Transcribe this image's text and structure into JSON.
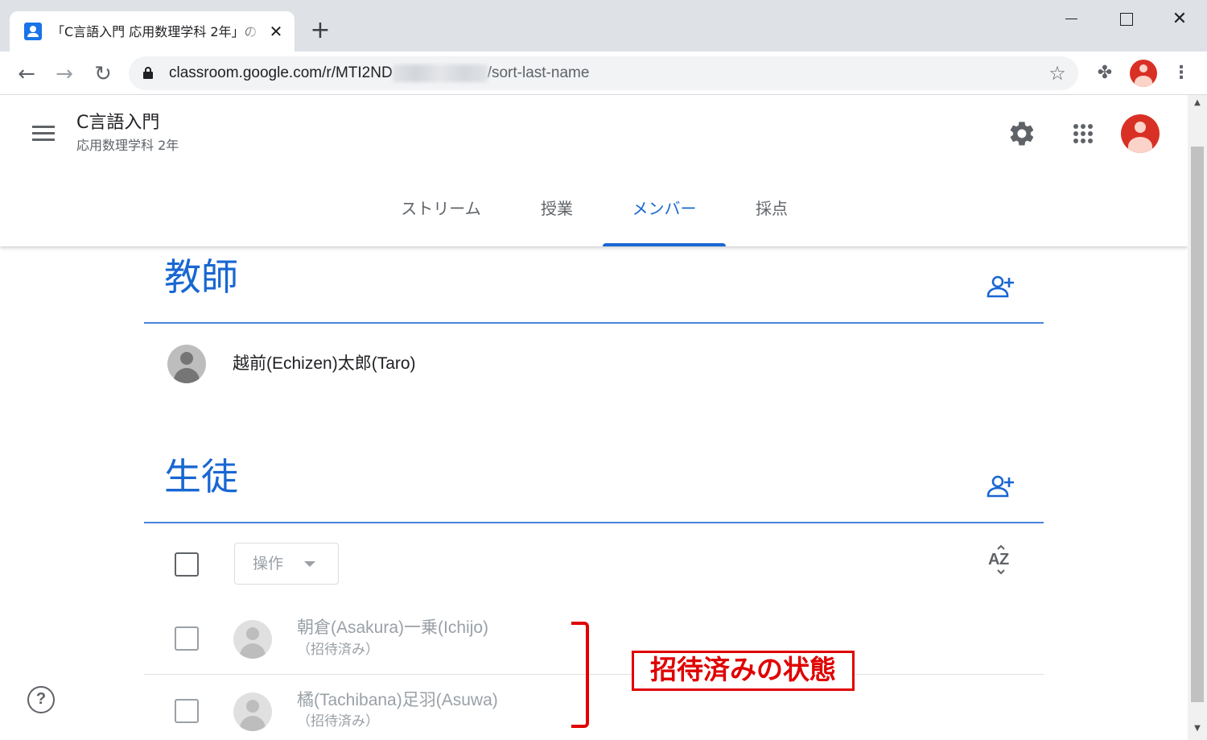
{
  "browser": {
    "tab_title": "「C言語入門 応用数理学科 2年」の",
    "new_tab_label": "+",
    "url_host": "classroom.google.com/r/MTI2ND",
    "url_path": "/sort-last-name"
  },
  "header": {
    "class_name": "C言語入門",
    "class_section": "応用数理学科 2年"
  },
  "tabs": [
    {
      "label": "ストリーム",
      "active": false
    },
    {
      "label": "授業",
      "active": false
    },
    {
      "label": "メンバー",
      "active": true
    },
    {
      "label": "採点",
      "active": false
    }
  ],
  "teachers": {
    "title": "教師",
    "items": [
      {
        "name": "越前(Echizen)太郎(Taro)"
      }
    ]
  },
  "students": {
    "title": "生徒",
    "actions_label": "操作",
    "items": [
      {
        "name": "朝倉(Asakura)一乗(Ichijo)",
        "status": "（招待済み）"
      },
      {
        "name": "橘(Tachibana)足羽(Asuwa)",
        "status": "（招待済み）"
      }
    ]
  },
  "annotation": {
    "callout": "招待済みの状態",
    "color": "#e00000"
  },
  "colors": {
    "accent": "#1967d2",
    "muted_text": "#9aa0a6"
  }
}
